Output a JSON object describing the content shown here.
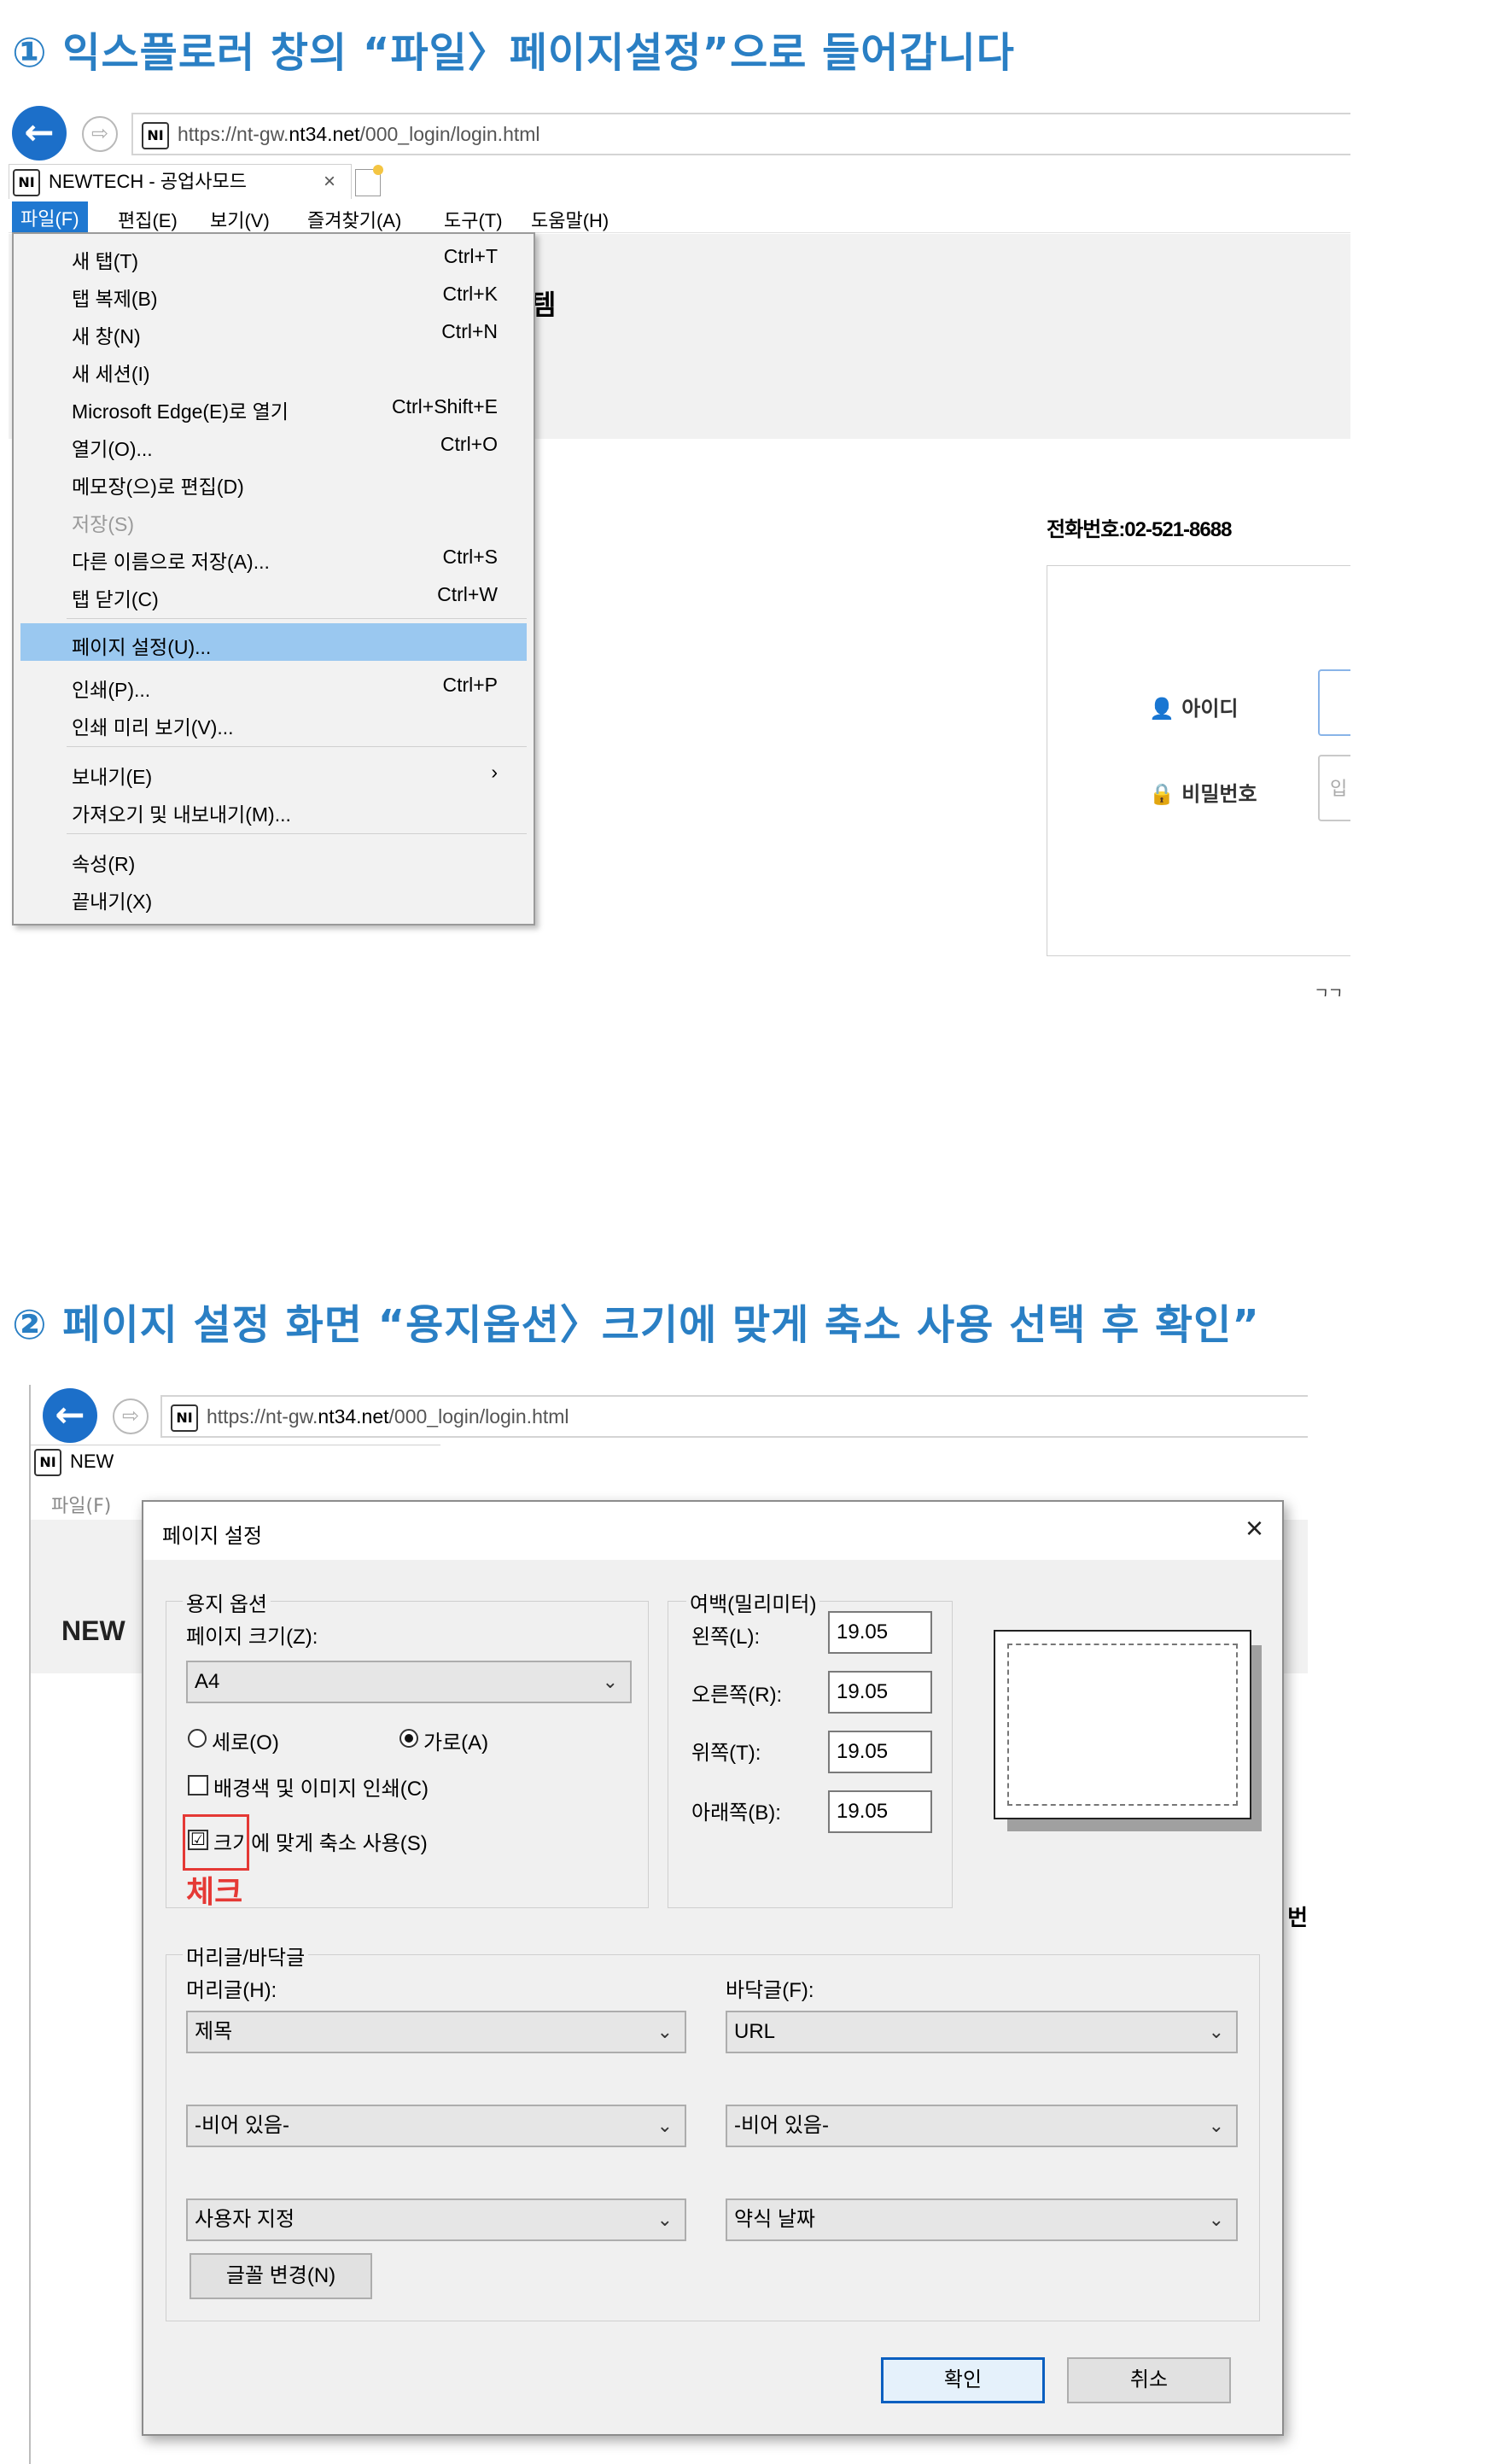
{
  "step1": {
    "heading": "① 익스플로러 창의 “파일〉페이지설정”으로 들어갑니다",
    "browser": {
      "url_prefix": "https://nt-gw.",
      "url_bold": "nt34.net",
      "url_suffix": "/000_login/login.html",
      "site_icon_text": "NI",
      "tab_title": "NEWTECH - 공업사모드",
      "tab_close": "×",
      "menubar": [
        "파일(F)",
        "편집(E)",
        "보기(V)",
        "즐겨찾기(A)",
        "도구(T)",
        "도움말(H)"
      ],
      "page_fragment": "템",
      "phone": "전화번호:02-521-8688",
      "login_id_label": "아이디",
      "login_pw_label": "비밀번호",
      "login_pw_placeholder": "입",
      "bottom_fragment": "그그"
    },
    "file_menu": [
      {
        "label": "새 탭(T)",
        "shortcut": "Ctrl+T"
      },
      {
        "label": "탭 복제(B)",
        "shortcut": "Ctrl+K"
      },
      {
        "label": "새 창(N)",
        "shortcut": "Ctrl+N"
      },
      {
        "label": "새 세션(I)",
        "shortcut": ""
      },
      {
        "label": "Microsoft Edge(E)로 열기",
        "shortcut": "Ctrl+Shift+E"
      },
      {
        "label": "열기(O)...",
        "shortcut": "Ctrl+O"
      },
      {
        "label": "메모장(으)로 편집(D)",
        "shortcut": ""
      },
      {
        "label": "저장(S)",
        "shortcut": ""
      },
      {
        "label": "다른 이름으로 저장(A)...",
        "shortcut": "Ctrl+S"
      },
      {
        "label": "탭 닫기(C)",
        "shortcut": "Ctrl+W"
      },
      {
        "label": "페이지 설정(U)...",
        "shortcut": ""
      },
      {
        "label": "인쇄(P)...",
        "shortcut": "Ctrl+P"
      },
      {
        "label": "인쇄 미리 보기(V)...",
        "shortcut": ""
      },
      {
        "label": "보내기(E)",
        "shortcut": "›"
      },
      {
        "label": "가져오기 및 내보내기(M)...",
        "shortcut": ""
      },
      {
        "label": "속성(R)",
        "shortcut": ""
      },
      {
        "label": "끝내기(X)",
        "shortcut": ""
      }
    ]
  },
  "step2": {
    "heading": "② 페이지 설정 화면 “용지옵션〉크기에 맞게 축소 사용 선택 후 확인”",
    "browser": {
      "url_prefix": "https://nt-gw.",
      "url_bold": "nt34.net",
      "url_suffix": "/000_login/login.html",
      "site_icon_text": "NI",
      "tab_fragment": "NEW",
      "menu_fragment": "파일(F)",
      "page_title_fragment": "NEW",
      "right_fragment": "번"
    },
    "dialog": {
      "title": "페이지 설정",
      "close": "×",
      "paper_group": "용지 옵션",
      "page_size_label": "페이지 크기(Z):",
      "page_size_value": "A4",
      "portrait_label": "세로(O)",
      "landscape_label": "가로(A)",
      "orientation": "landscape",
      "print_bg_label": "배경색 및 이미지 인쇄(C)",
      "print_bg_checked": false,
      "shrink_label": "크기에 맞게 축소 사용(S)",
      "shrink_checked": true,
      "check_mark": "☑",
      "annotation": "체크",
      "margins_group": "여백(밀리미터)",
      "margin_left_label": "왼쪽(L):",
      "margin_left": "19.05",
      "margin_right_label": "오른쪽(R):",
      "margin_right": "19.05",
      "margin_top_label": "위쪽(T):",
      "margin_top": "19.05",
      "margin_bottom_label": "아래쪽(B):",
      "margin_bottom": "19.05",
      "hf_group": "머리글/바닥글",
      "header_label": "머리글(H):",
      "footer_label": "바닥글(F):",
      "header1": "제목",
      "footer1": "URL",
      "header2": "-비어 있음-",
      "footer2": "-비어 있음-",
      "header3": "사용자 지정",
      "footer3": "약식 날짜",
      "font_button": "글꼴 변경(N)",
      "ok_button": "확인",
      "cancel_button": "취소"
    }
  },
  "colors": {
    "heading": "#2a7fc4",
    "menu_highlight": "#9ac8f0",
    "annotation_red": "#e53935",
    "back_button": "#1c6fc9"
  }
}
